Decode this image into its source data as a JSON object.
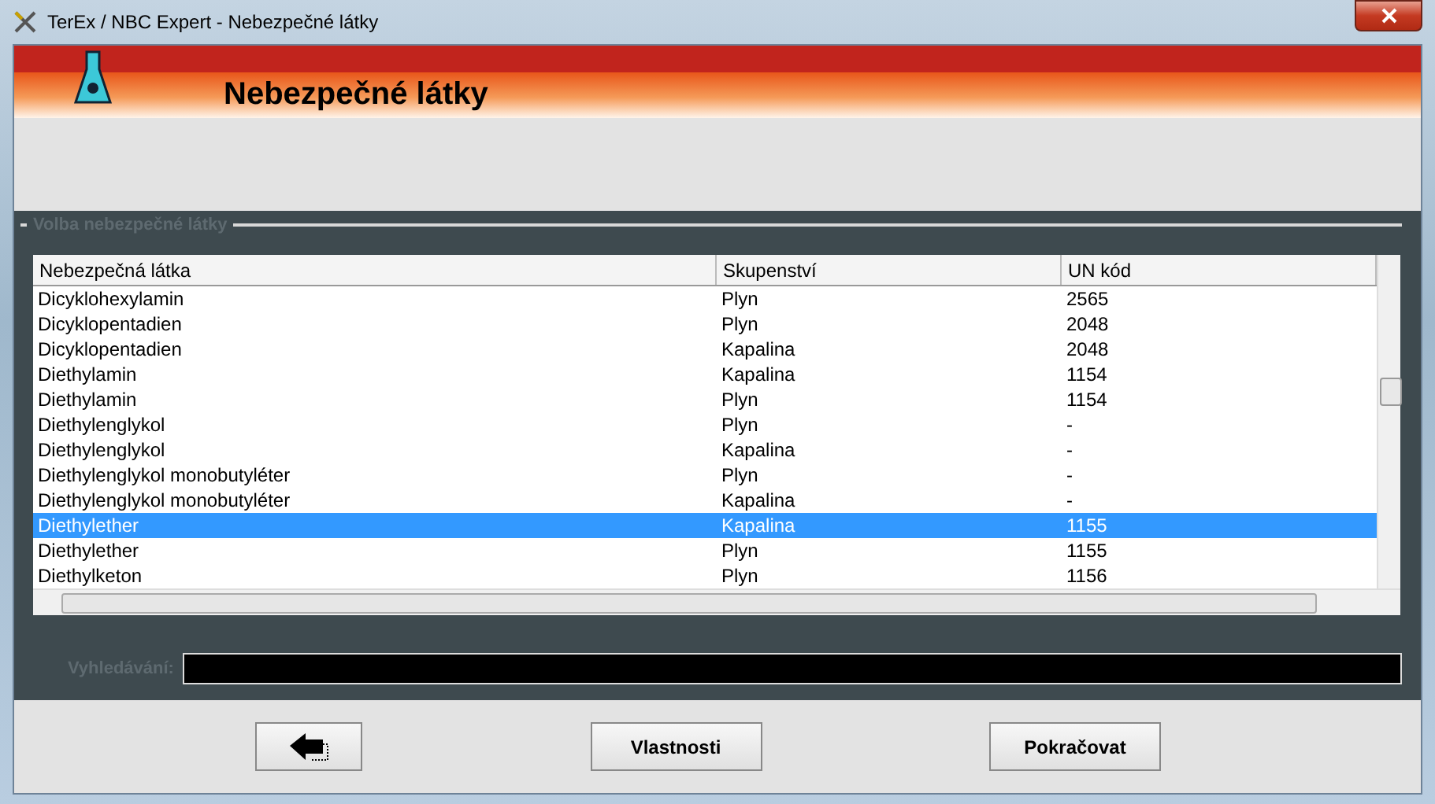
{
  "window": {
    "title": "TerEx / NBC Expert  - Nebezpečné látky"
  },
  "header": {
    "title": "Nebezpečné látky"
  },
  "group": {
    "label": "Volba nebezpečné látky"
  },
  "table": {
    "columns": [
      "Nebezpečná látka",
      "Skupenství",
      "UN kód"
    ],
    "rows": [
      {
        "cells": [
          "Dicyklohexylamin",
          "Plyn",
          "2565"
        ],
        "selected": false
      },
      {
        "cells": [
          "Dicyklopentadien",
          "Plyn",
          "2048"
        ],
        "selected": false
      },
      {
        "cells": [
          "Dicyklopentadien",
          "Kapalina",
          "2048"
        ],
        "selected": false
      },
      {
        "cells": [
          "Diethylamin",
          "Kapalina",
          "1154"
        ],
        "selected": false
      },
      {
        "cells": [
          "Diethylamin",
          "Plyn",
          "1154"
        ],
        "selected": false
      },
      {
        "cells": [
          "Diethylenglykol",
          "Plyn",
          "-"
        ],
        "selected": false
      },
      {
        "cells": [
          "Diethylenglykol",
          "Kapalina",
          "-"
        ],
        "selected": false
      },
      {
        "cells": [
          "Diethylenglykol monobutyléter",
          "Plyn",
          "-"
        ],
        "selected": false
      },
      {
        "cells": [
          "Diethylenglykol monobutyléter",
          "Kapalina",
          "-"
        ],
        "selected": false
      },
      {
        "cells": [
          "Diethylether",
          "Kapalina",
          "1155"
        ],
        "selected": true
      },
      {
        "cells": [
          "Diethylether",
          "Plyn",
          "1155"
        ],
        "selected": false
      },
      {
        "cells": [
          "Diethylketon",
          "Plyn",
          "1156"
        ],
        "selected": false
      }
    ]
  },
  "search": {
    "label": "Vyhledávání:"
  },
  "buttons": [
    {
      "kind": "back"
    },
    {
      "kind": "text",
      "label": "Vlastnosti"
    },
    {
      "kind": "text",
      "label": "Pokračovat"
    }
  ]
}
